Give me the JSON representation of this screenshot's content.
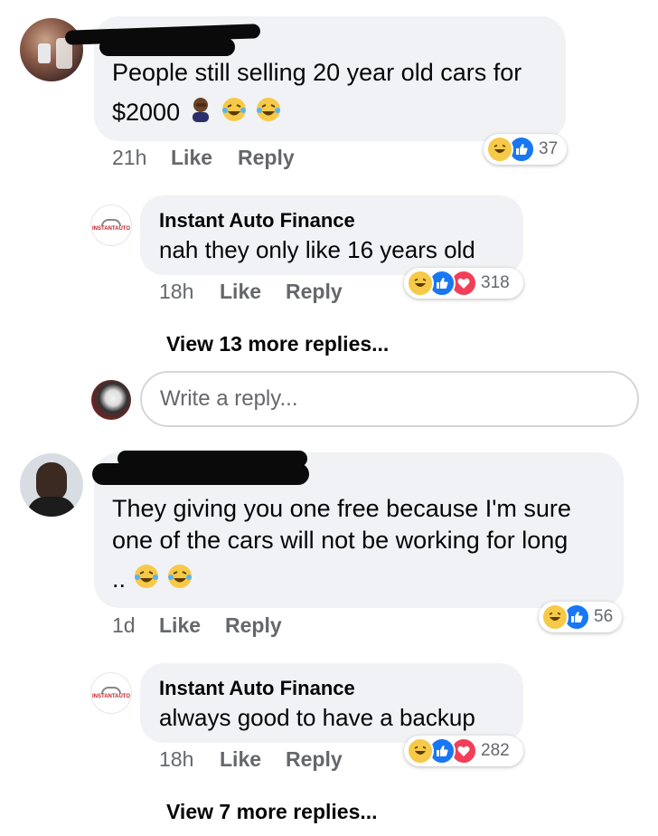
{
  "comment1": {
    "text_line1": "People still selling 20 year old cars for",
    "text_line2": "$2000",
    "emojis": [
      "facepalm-emoji",
      "laughing-tears-emoji",
      "laughing-tears-emoji"
    ],
    "time": "21h",
    "like_label": "Like",
    "reply_label": "Reply",
    "reaction_icons": [
      "haha-icon",
      "like-icon"
    ],
    "reaction_count": "37"
  },
  "reply1": {
    "author": "Instant Auto Finance",
    "logo_text": "INSTANTAUTO",
    "text": "nah they only like 16 years old",
    "time": "18h",
    "like_label": "Like",
    "reply_label": "Reply",
    "reaction_icons": [
      "haha-icon",
      "like-icon",
      "love-icon"
    ],
    "reaction_count": "318"
  },
  "view_more_1": "View 13 more replies...",
  "reply_input": {
    "placeholder": "Write a reply..."
  },
  "comment2": {
    "text_line1": "They giving you  one free because I'm sure",
    "text_line2": "one of the cars will not be working for long",
    "text_line3": "..",
    "emojis": [
      "laughing-tears-emoji",
      "laughing-tears-emoji"
    ],
    "time": "1d",
    "like_label": "Like",
    "reply_label": "Reply",
    "reaction_icons": [
      "haha-icon",
      "like-icon"
    ],
    "reaction_count": "56"
  },
  "reply2": {
    "author": "Instant Auto Finance",
    "logo_text": "INSTANTAUTO",
    "text": "always good to have a backup",
    "time": "18h",
    "like_label": "Like",
    "reply_label": "Reply",
    "reaction_icons": [
      "haha-icon",
      "like-icon",
      "love-icon"
    ],
    "reaction_count": "282"
  },
  "view_more_2": "View 7 more replies...",
  "colors": {
    "bubble": "#f0f2f5",
    "meta_text": "#65676b",
    "like_blue": "#1877f2",
    "love_red": "#f33e58",
    "haha_yellow": "#f7c948"
  }
}
